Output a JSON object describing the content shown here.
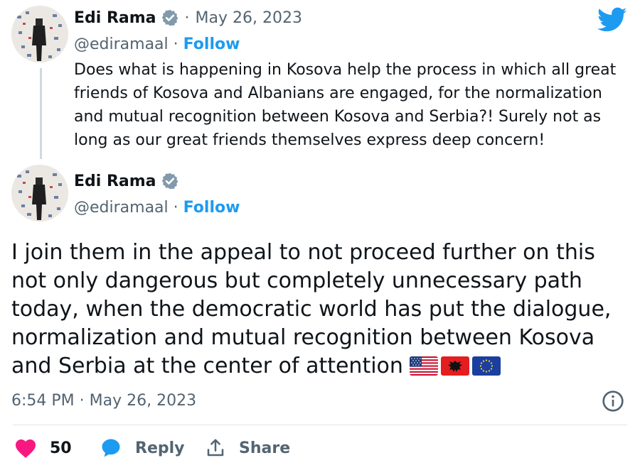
{
  "quoted_tweet": {
    "author_name": "Edi Rama",
    "date": "May 26, 2023",
    "handle": "@ediramaal",
    "follow_label": "Follow",
    "text": "Does what is happening in Kosova help the process in which all great friends of Kosova and Albanians are engaged, for the normalization and mutual recognition between Kosova and Serbia?! Surely not as long as our great friends themselves express deep concern!"
  },
  "main_tweet": {
    "author_name": "Edi Rama",
    "handle": "@ediramaal",
    "follow_label": "Follow",
    "text": "I join them in the appeal to not proceed further on this not only dangerous but completely unnecessary path today, when the democratic world has put the dialogue, normalization and mutual recognition between Kosova and Serbia at the center of attention",
    "flags": [
      "us-flag",
      "albania-flag",
      "eu-flag"
    ],
    "timestamp": "6:54 PM · May 26, 2023"
  },
  "actions": {
    "like_count": "50",
    "reply_label": "Reply",
    "share_label": "Share"
  },
  "icons": {
    "brand": "twitter-bird-icon",
    "info": "info-icon",
    "like": "heart-icon",
    "reply": "reply-bubble-icon",
    "share": "share-icon",
    "verified": "verified-badge-icon"
  },
  "colors": {
    "twitter_blue": "#1d9bf0",
    "like_pink": "#f91880",
    "secondary_text": "#536471"
  }
}
